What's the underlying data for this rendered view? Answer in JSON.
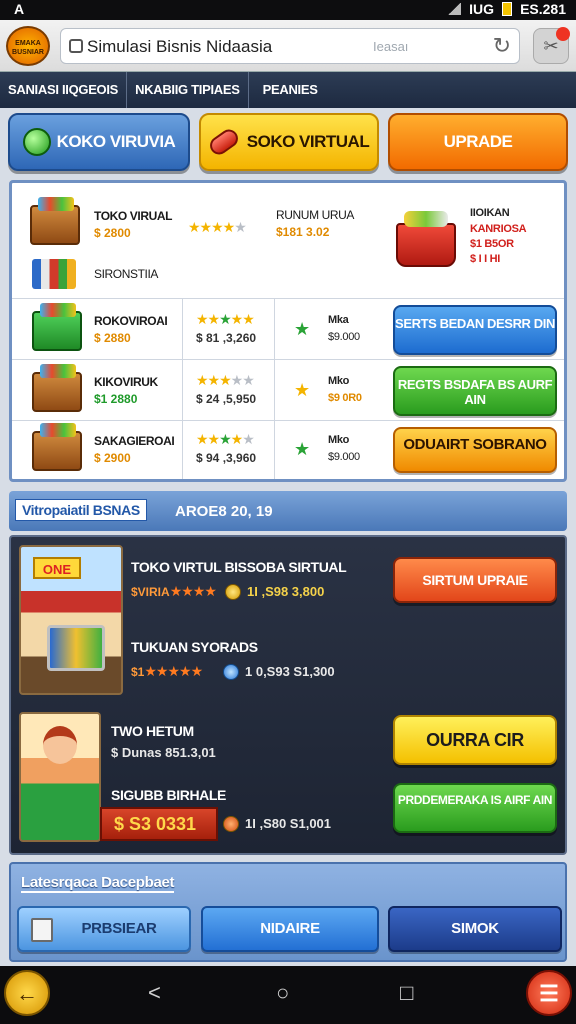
{
  "status": {
    "left": "A",
    "carrier": "IUG",
    "time": "ES.281"
  },
  "browser": {
    "app_logo": "EMAKA BUSNIAR",
    "title": "Simulasi Bisnis Nidaasia",
    "hint": "Ieasaı"
  },
  "tabs": [
    "SANIASI IIQGEOIS",
    "NKABIIG TIPIAES",
    "PEANIES"
  ],
  "top_buttons": [
    "KOKO VIRUVIA",
    "SOKO VIRTUAL",
    "UPRADE"
  ],
  "shop": {
    "featured": {
      "name": "TOKO VIRUAL",
      "price": "$ 2800",
      "sub": "SIRONSTIIA",
      "mid_title": "RUNUM URUA",
      "mid_value": "$181 3.02",
      "promo_title": "IIOIKAN",
      "promo_sub": "KANRIOSA",
      "promo_line1": "$1 B5OR",
      "promo_line2": "$ I I HI"
    },
    "rows": [
      {
        "name": "ROKOVIROAI",
        "price": "$ 2880",
        "value": "$ 81 ,3,260",
        "tag": "Mka",
        "tag_value": "$9.000",
        "button": "SERTS BEDAN DESRR DIN"
      },
      {
        "name": "KIKOVIRUK",
        "price": "$1 2880",
        "value": "$ 24 ,5,950",
        "tag": "Mko",
        "tag_value": "$9 0R0",
        "button": "REGTS BSDAFA BS AURF AIN"
      },
      {
        "name": "SAKAGIEROAI",
        "price": "$ 2900",
        "value": "$ 94 ,3,960",
        "tag": "Mko",
        "tag_value": "$9.000",
        "button": "ODUAIRT SOBRANO"
      }
    ]
  },
  "section": {
    "label": "Vitropaiatil BSNAS",
    "info": "AROE8 20, 19"
  },
  "business": {
    "item1": {
      "title": "TOKO VIRTUL BISSOBA SIRTUAL",
      "stars_label": "$VIRIA",
      "value": "1I ,S98 3,800",
      "button": "SIRTUM UPRAIE"
    },
    "item2": {
      "title": "TUKUAN SYORADS",
      "stars_label": "$1",
      "value": "1 0,S93 S1,300"
    },
    "item3": {
      "title": "TWO HETUM",
      "value": "$ Dunas 851.3,01",
      "button": "OURRA CIR"
    },
    "item4": {
      "title": "SIGUBB BIRHALE",
      "price_badge": "$ S3 0331",
      "value": "1I ,S80 S1,001",
      "button": "PRDDEMERAKA IS AIRF AIN"
    },
    "sign": "ONE"
  },
  "bottom": {
    "label": "Latesrqaca Dacepbaet",
    "buttons": [
      "PRBSIEAR",
      "NIDAIRE",
      "SIMOK"
    ]
  },
  "nav": {
    "back": "←",
    "home": "○",
    "recent": "□",
    "menu": "☰"
  }
}
